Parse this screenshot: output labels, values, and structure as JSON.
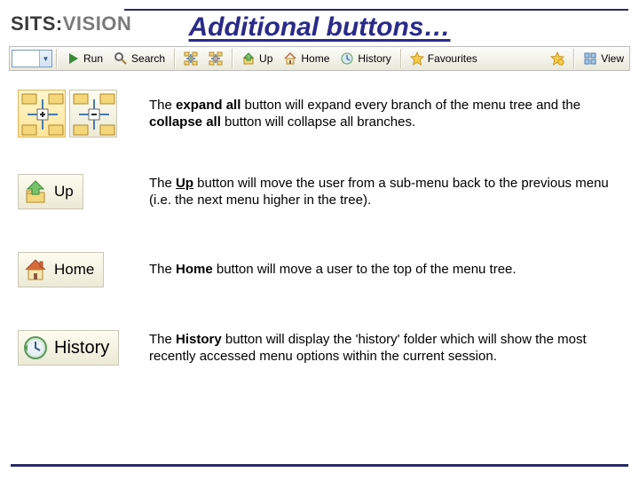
{
  "logo": {
    "left": "SITS:",
    "right": "VISION"
  },
  "title": "Additional buttons…",
  "toolbar": {
    "run": "Run",
    "search": "Search",
    "up": "Up",
    "home": "Home",
    "history": "History",
    "favourites": "Favourites",
    "view": "View"
  },
  "rows": {
    "expand": {
      "text_before": "The ",
      "b1": "expand all",
      "mid1": " button will expand every branch of the menu tree and the ",
      "b2": "collapse all",
      "after": " button will collapse all branches."
    },
    "up": {
      "label": "Up",
      "text_before": "The ",
      "b": "Up",
      "after": " button will move the user from a sub-menu back to the previous menu (i.e. the next menu higher in the tree)."
    },
    "home": {
      "label": "Home",
      "text_before": "The ",
      "b": "Home",
      "after": " button will move a user to the top of the menu tree."
    },
    "history": {
      "label": "History",
      "text_before": "The ",
      "b": "History",
      "after": " button will display the 'history' folder which will show the most recently accessed menu options within the current session."
    }
  }
}
